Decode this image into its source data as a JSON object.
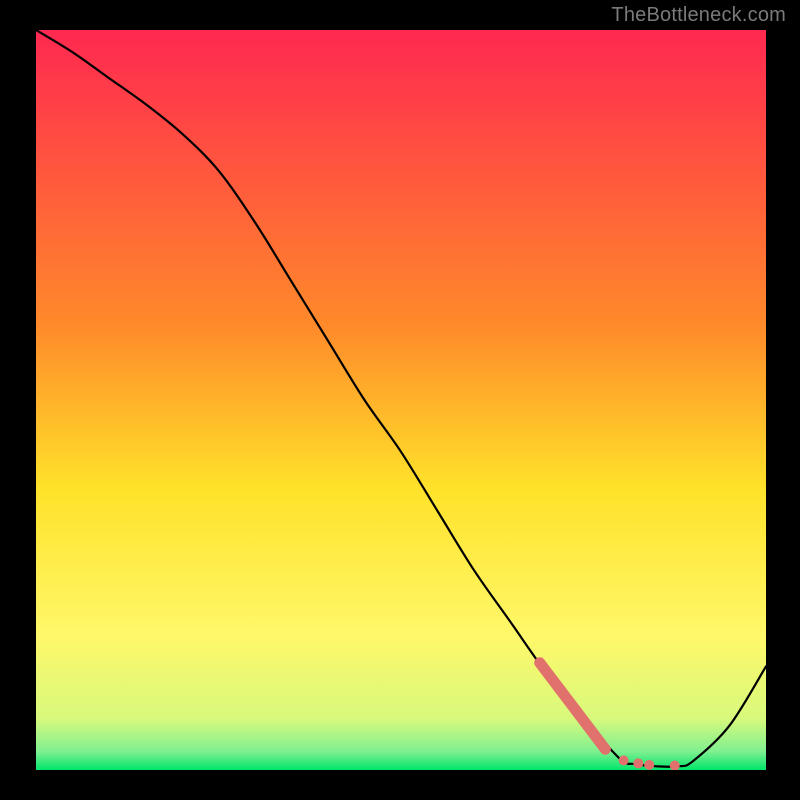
{
  "watermark": {
    "text": "TheBottleneck.com"
  },
  "colors": {
    "background_black": "#000000",
    "watermark_gray": "#7a7a7a",
    "curve_black": "#000000",
    "marker_red": "#e0716c",
    "gradient_top": "#ff2850",
    "gradient_yellow": "#fff200",
    "gradient_green": "#00e56b"
  },
  "chart_data": {
    "type": "line",
    "title": "",
    "xlabel": "",
    "ylabel": "",
    "xlim": [
      0,
      100
    ],
    "ylim": [
      0,
      100
    ],
    "x": [
      0,
      5,
      10,
      15,
      20,
      25,
      30,
      35,
      40,
      45,
      50,
      55,
      60,
      65,
      70,
      75,
      80,
      82,
      85,
      88,
      90,
      95,
      100
    ],
    "values": [
      100,
      97,
      93.5,
      90,
      86,
      81,
      74,
      66,
      58,
      50,
      43,
      35,
      27,
      20,
      13,
      7,
      1.5,
      0.8,
      0.5,
      0.5,
      1.2,
      6,
      14
    ],
    "markers_segment": {
      "x_start": 69,
      "y_start": 14.5,
      "x_end": 78,
      "y_end": 2.8
    },
    "markers_dots": [
      {
        "x": 80.5,
        "y": 1.3
      },
      {
        "x": 82.5,
        "y": 0.9
      },
      {
        "x": 84.0,
        "y": 0.7
      },
      {
        "x": 87.5,
        "y": 0.6
      }
    ],
    "background_gradient_stops": [
      {
        "offset": 0.0,
        "color": "#ff2850"
      },
      {
        "offset": 0.4,
        "color": "#ff8a2a"
      },
      {
        "offset": 0.62,
        "color": "#ffe22a"
      },
      {
        "offset": 0.82,
        "color": "#fff86a"
      },
      {
        "offset": 0.93,
        "color": "#d8f97c"
      },
      {
        "offset": 0.975,
        "color": "#7ff090"
      },
      {
        "offset": 1.0,
        "color": "#00e56b"
      }
    ]
  }
}
